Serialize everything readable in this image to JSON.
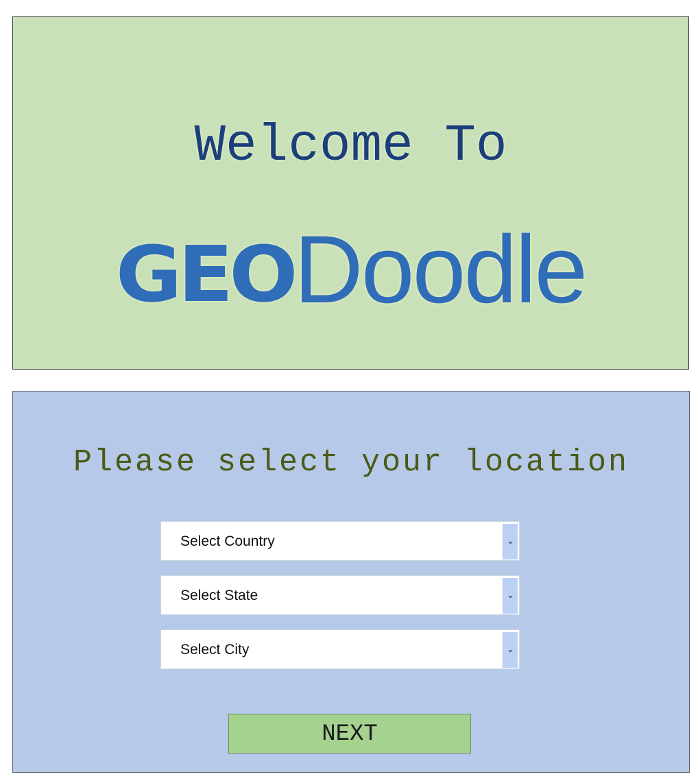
{
  "welcome": {
    "heading": "Welcome To",
    "logo_part1": "GEO",
    "logo_part2": "Doodle"
  },
  "location": {
    "title": "Please select your location",
    "selects": [
      {
        "label": "Select Country"
      },
      {
        "label": "Select State"
      },
      {
        "label": "Select City"
      }
    ],
    "next_label": "NEXT"
  },
  "icons": {
    "dropdown": "chevron-down-icon"
  },
  "colors": {
    "welcome_bg": "#c9e1b8",
    "location_bg": "#b6c9e8",
    "logo_blue": "#2f6db8",
    "next_bg": "#a6d28f"
  }
}
